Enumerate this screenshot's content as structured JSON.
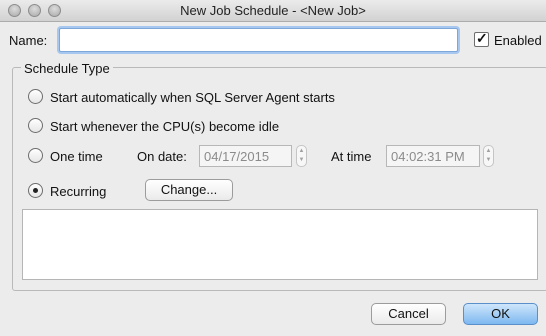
{
  "window": {
    "title": "New Job Schedule - <New Job>"
  },
  "name": {
    "label": "Name:",
    "value": "",
    "placeholder": ""
  },
  "enabled": {
    "label": "Enabled",
    "checked": true
  },
  "schedule": {
    "title": "Schedule Type",
    "options": [
      {
        "label": "Start automatically when SQL Server Agent starts",
        "selected": false
      },
      {
        "label": "Start whenever the CPU(s) become idle",
        "selected": false
      },
      {
        "label": "One time",
        "selected": false
      },
      {
        "label": "Recurring",
        "selected": true
      }
    ],
    "on_date_label": "On date:",
    "on_date_value": "04/17/2015",
    "at_time_label": "At time",
    "at_time_value": "04:02:31 PM",
    "change_button": "Change..."
  },
  "buttons": {
    "cancel": "Cancel",
    "ok": "OK"
  },
  "icons": {
    "spinner": "up-down-arrows",
    "check": "checkmark"
  }
}
